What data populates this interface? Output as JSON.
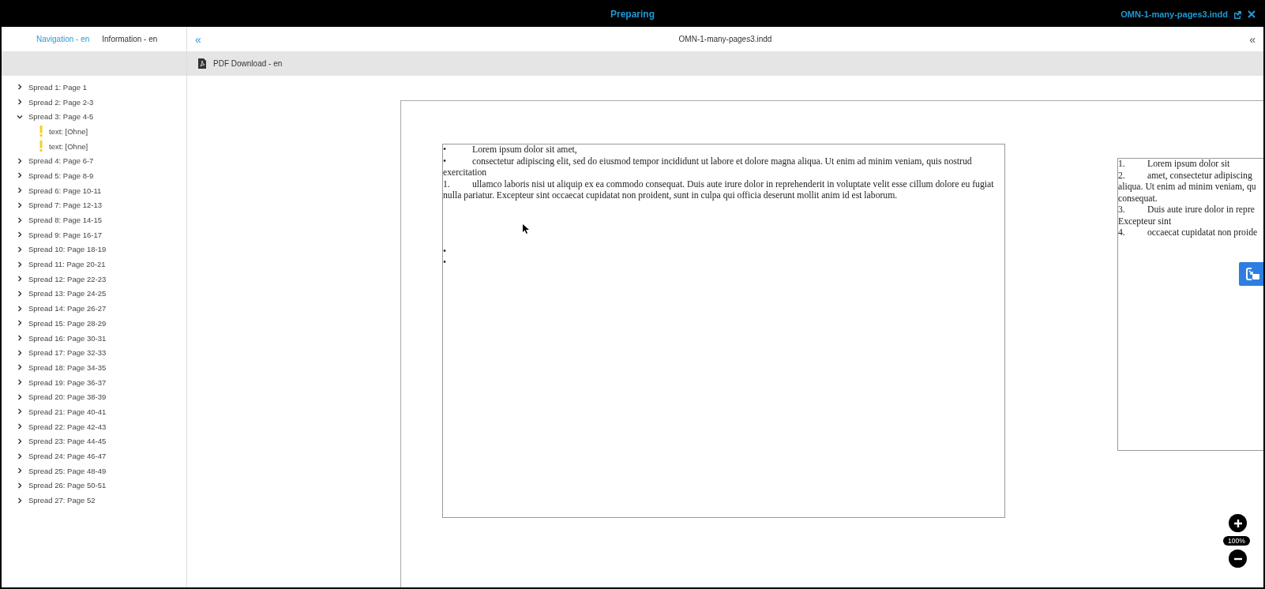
{
  "header": {
    "title": "Preparing",
    "file_name": "OMN-1-many-pages3.indd"
  },
  "sidebar": {
    "tabs": [
      {
        "label": "Navigation - en",
        "selected": true
      },
      {
        "label": "Information - en",
        "selected": false
      }
    ],
    "tree": [
      {
        "label": "Spread 1: Page 1",
        "expanded": false
      },
      {
        "label": "Spread 2: Page 2-3",
        "expanded": false
      },
      {
        "label": "Spread 3: Page 4-5",
        "expanded": true,
        "children": [
          {
            "label": "text: [Ohne]"
          },
          {
            "label": "text: [Ohne]"
          }
        ]
      },
      {
        "label": "Spread 4: Page 6-7",
        "expanded": false
      },
      {
        "label": "Spread 5: Page 8-9",
        "expanded": false
      },
      {
        "label": "Spread 6: Page 10-11",
        "expanded": false
      },
      {
        "label": "Spread 7: Page 12-13",
        "expanded": false
      },
      {
        "label": "Spread 8: Page 14-15",
        "expanded": false
      },
      {
        "label": "Spread 9: Page 16-17",
        "expanded": false
      },
      {
        "label": "Spread 10: Page 18-19",
        "expanded": false
      },
      {
        "label": "Spread 11: Page 20-21",
        "expanded": false
      },
      {
        "label": "Spread 12: Page 22-23",
        "expanded": false
      },
      {
        "label": "Spread 13: Page 24-25",
        "expanded": false
      },
      {
        "label": "Spread 14: Page 26-27",
        "expanded": false
      },
      {
        "label": "Spread 15: Page 28-29",
        "expanded": false
      },
      {
        "label": "Spread 16: Page 30-31",
        "expanded": false
      },
      {
        "label": "Spread 17: Page 32-33",
        "expanded": false
      },
      {
        "label": "Spread 18: Page 34-35",
        "expanded": false
      },
      {
        "label": "Spread 19: Page 36-37",
        "expanded": false
      },
      {
        "label": "Spread 20: Page 38-39",
        "expanded": false
      },
      {
        "label": "Spread 21: Page 40-41",
        "expanded": false
      },
      {
        "label": "Spread 22: Page 42-43",
        "expanded": false
      },
      {
        "label": "Spread 23: Page 44-45",
        "expanded": false
      },
      {
        "label": "Spread 24: Page 46-47",
        "expanded": false
      },
      {
        "label": "Spread 25: Page 48-49",
        "expanded": false
      },
      {
        "label": "Spread 26: Page 50-51",
        "expanded": false
      },
      {
        "label": "Spread 27: Page 52",
        "expanded": false
      }
    ]
  },
  "main": {
    "collapse_left": "«",
    "document_title": "OMN-1-many-pages3.indd",
    "collapse_right": "«",
    "download_label": "PDF Download - en"
  },
  "text_frame_1": {
    "paragraphs": [
      {
        "marker": "•",
        "text": "Lorem ipsum dolor sit amet,"
      },
      {
        "marker": "•",
        "text": "consectetur adipiscing elit, sed do eiusmod tempor incididunt ut labore et dolore magna aliqua. Ut enim ad minim veniam, quis nostrud exercitation"
      },
      {
        "marker": "1.",
        "text": "ullamco laboris nisi ut aliquip ex ea commodo consequat. Duis aute irure dolor in reprehenderit in voluptate velit esse cillum dolore eu fugiat nulla pariatur. Excepteur sint occaecat cupidatat non proident, sunt in culpa qui officia deserunt mollit anim id est laborum."
      }
    ],
    "empty_markers": [
      "•",
      "•"
    ]
  },
  "text_frame_2": {
    "lines": [
      {
        "marker": "1.",
        "text": "Lorem ipsum dolor sit"
      },
      {
        "marker": "2.",
        "text": "amet, consectetur adipiscing"
      },
      {
        "text": "aliqua. Ut enim ad minim veniam, qu"
      },
      {
        "text": "consequat."
      },
      {
        "marker": "3.",
        "text": "Duis aute irure dolor in repre"
      },
      {
        "text": "Excepteur sint"
      },
      {
        "marker": "4.",
        "text": "occaecat cupidatat non proide"
      }
    ]
  },
  "zoom": {
    "level_label": "100%"
  }
}
